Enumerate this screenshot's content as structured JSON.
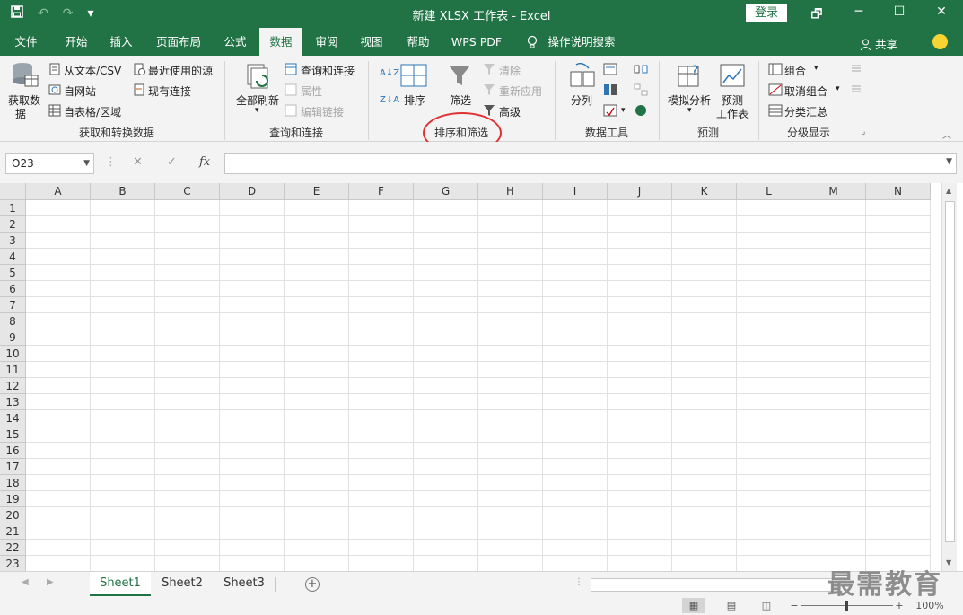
{
  "window": {
    "title": "新建 XLSX 工作表  -  Excel",
    "login_label": "登录",
    "undo_glyph": "↶",
    "redo_glyph": "↷",
    "qat_more_glyph": "▾",
    "restore_glyph": "🗗",
    "minimize_glyph": "─",
    "maximize_glyph": "☐",
    "close_glyph": "✕"
  },
  "tabs": [
    {
      "label": "文件"
    },
    {
      "label": "开始"
    },
    {
      "label": "插入"
    },
    {
      "label": "页面布局"
    },
    {
      "label": "公式"
    },
    {
      "label": "数据"
    },
    {
      "label": "审阅"
    },
    {
      "label": "视图"
    },
    {
      "label": "帮助"
    },
    {
      "label": "WPS PDF"
    },
    {
      "label": "操作说明搜索"
    }
  ],
  "active_tab": "数据",
  "share_label": "共享",
  "ribbon": {
    "get_data": {
      "big_button_line1": "获取数",
      "big_button_line2": "据",
      "from_text_csv": "从文本/CSV",
      "from_web": "自网站",
      "from_table": "自表格/区域",
      "recent_sources": "最近使用的源",
      "existing_connections": "现有连接",
      "group_label": "获取和转换数据"
    },
    "queries": {
      "refresh_all": "全部刷新",
      "queries_connections": "查询和连接",
      "properties": "属性",
      "edit_links": "编辑链接",
      "group_label": "查询和连接"
    },
    "sort_filter": {
      "sort": "排序",
      "filter": "筛选",
      "clear": "清除",
      "reapply": "重新应用",
      "advanced": "高级",
      "group_label": "排序和筛选",
      "az_glyph": "A↓Z",
      "za_glyph": "Z↓A"
    },
    "data_tools": {
      "text_to_columns": "分列",
      "group_label": "数据工具"
    },
    "forecast": {
      "what_if": "模拟分析",
      "forecast_sheet_line1": "预测",
      "forecast_sheet_line2": "工作表",
      "group_label": "预测"
    },
    "outline": {
      "group": "组合",
      "ungroup": "取消组合",
      "subtotal": "分类汇总",
      "group_label": "分级显示"
    }
  },
  "formula_bar": {
    "name_box": "O23",
    "cancel_glyph": "✕",
    "enter_glyph": "✓",
    "fx_glyph": "fx",
    "formula": ""
  },
  "grid": {
    "columns": [
      "A",
      "B",
      "C",
      "D",
      "E",
      "F",
      "G",
      "H",
      "I",
      "J",
      "K",
      "L",
      "M",
      "N"
    ],
    "rows": [
      "1",
      "2",
      "3",
      "4",
      "5",
      "6",
      "7",
      "8",
      "9",
      "10",
      "11",
      "12",
      "13",
      "14",
      "15",
      "16",
      "17",
      "18",
      "19",
      "20",
      "21",
      "22",
      "23"
    ]
  },
  "sheets": [
    {
      "label": "Sheet1"
    },
    {
      "label": "Sheet2"
    },
    {
      "label": "Sheet3"
    }
  ],
  "active_sheet": "Sheet1",
  "add_sheet_glyph": "+",
  "status": {
    "zoom_minus": "−",
    "zoom_plus": "+",
    "zoom_level": "100%"
  },
  "watermark": "最需教育",
  "colors": {
    "excel_green": "#217346",
    "annotation_red": "#e03232"
  }
}
